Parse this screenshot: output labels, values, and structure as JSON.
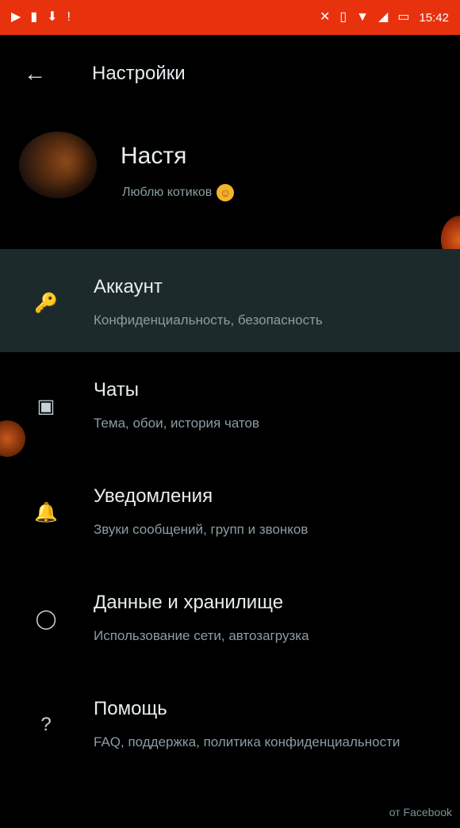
{
  "status_bar": {
    "time": "15:42",
    "bg_color": "#e8320e",
    "left_icons": [
      "youtube-icon",
      "clipboard-icon",
      "download-icon",
      "notification-icon"
    ],
    "right_icons": [
      "mute-icon",
      "vibrate-icon",
      "wifi-icon",
      "signal-icon",
      "battery-icon"
    ]
  },
  "app_bar": {
    "title": "Настройки",
    "back_icon": "back-arrow-icon"
  },
  "profile": {
    "name": "Настя",
    "status": "Люблю котиков",
    "status_emoji": "☺"
  },
  "menu": {
    "items": [
      {
        "title": "Аккаунт",
        "subtitle": "Конфиденциальность, безопасность",
        "icon": "key-icon",
        "selected": true
      },
      {
        "title": "Чаты",
        "subtitle": "Тема, обои, история чатов",
        "icon": "chat-icon",
        "selected": false
      },
      {
        "title": "Уведомления",
        "subtitle": "Звуки сообщений, групп и звонков",
        "icon": "bell-icon",
        "selected": false
      },
      {
        "title": "Данные и хранилище",
        "subtitle": "Использование сети, автозагрузка",
        "icon": "data-usage-icon",
        "selected": false
      },
      {
        "title": "Помощь",
        "subtitle": "FAQ, поддержка, политика конфиденциальности",
        "icon": "help-icon",
        "selected": false
      }
    ]
  },
  "footer": {
    "text": "от Facebook"
  },
  "colors": {
    "background": "#000000",
    "selected_row": "#1c2a2c",
    "primary_text": "#e8eef0",
    "secondary_text": "#8a9ea4",
    "accent": "#e8320e"
  }
}
